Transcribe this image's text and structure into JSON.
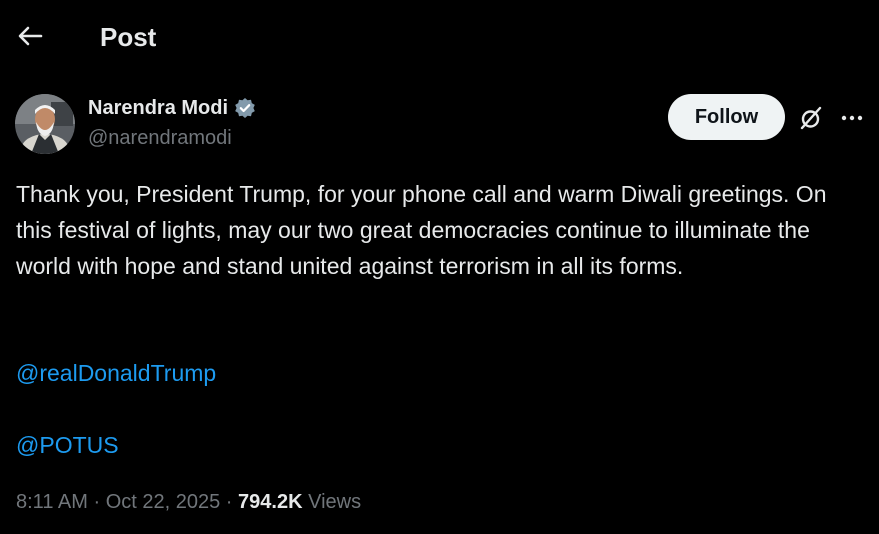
{
  "header": {
    "title": "Post"
  },
  "author": {
    "name": "Narendra Modi",
    "handle": "@narendramodi",
    "verified": true,
    "avatar": "profile-photo"
  },
  "actions": {
    "follow_label": "Follow"
  },
  "post": {
    "text": "Thank you, President Trump, for your phone call and warm Diwali greetings. On this festival of lights, may our two great democracies continue to illuminate the world with hope and stand united against terrorism in all its forms.",
    "mentions": [
      "@realDonaldTrump",
      "@POTUS"
    ]
  },
  "meta": {
    "time": "8:11 AM",
    "date": "Oct 22, 2025",
    "separator": "·",
    "views_count": "794.2K",
    "views_label": "Views"
  },
  "colors": {
    "background": "#000000",
    "text_primary": "#e7e9ea",
    "text_secondary": "#71767b",
    "link": "#1d9bf0",
    "follow_bg": "#eff3f4",
    "verified": "#829aab"
  },
  "icons": {
    "back": "arrow-left-icon",
    "verified": "verified-badge-icon",
    "grok": "grok-icon",
    "more": "more-horizontal-icon"
  }
}
